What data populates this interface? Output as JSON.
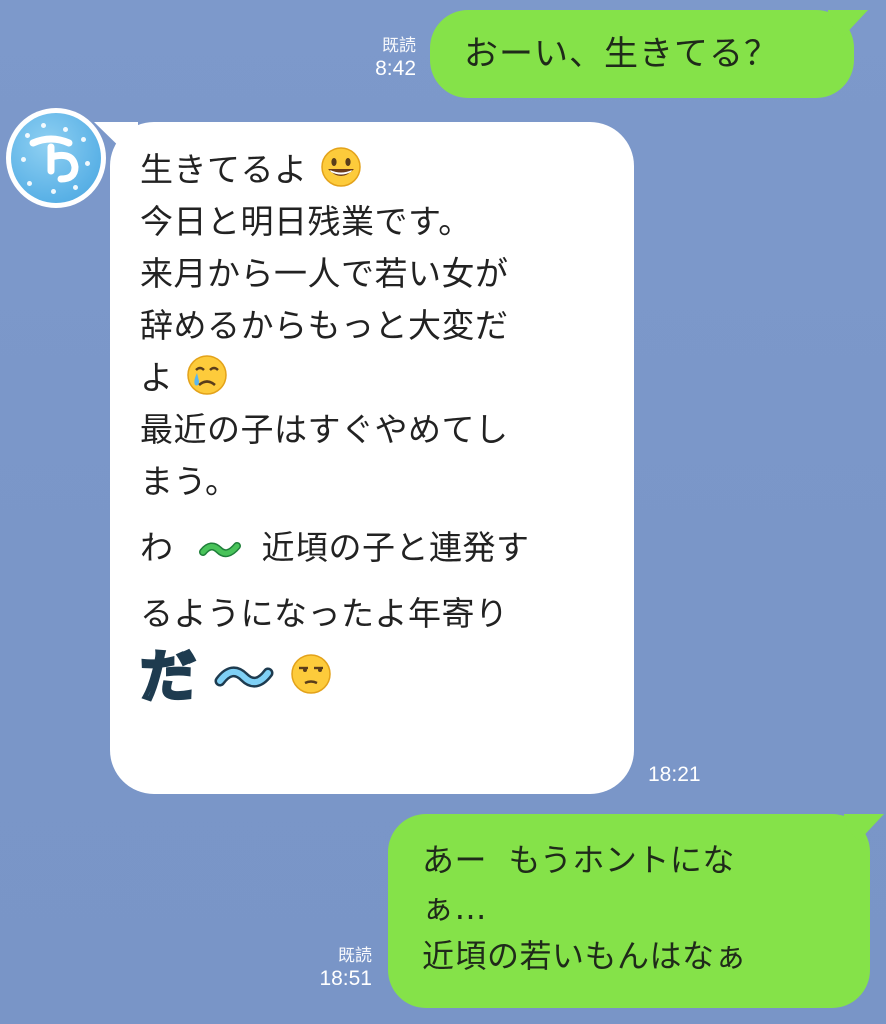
{
  "messages": {
    "m1": {
      "text": "おーい、生きてる？",
      "read": "既読",
      "time": "8:42"
    },
    "m2": {
      "lines": [
        "生きてるよ",
        "今日と明日残業です。",
        "来月から一人で若い女が",
        "辞めるからもっと大変だ",
        "よ",
        "最近の子はすぐやめてし",
        "まう。",
        "わ",
        "近頃の子と連発す",
        "るようになったよ年寄り"
      ],
      "big_text": "だ",
      "time": "18:21"
    },
    "m3": {
      "lines": [
        "あー  もうホントにな",
        "ぁ…",
        "近頃の若いもんはなぁ"
      ],
      "read": "既読",
      "time": "18:51"
    }
  },
  "icons": {
    "avatar": "note-avatar-icon",
    "smile": "grinning-face-emoji",
    "cry": "crying-face-emoji",
    "unamused": "unamused-face-emoji",
    "wave": "green-wave-deco",
    "tilde": "blue-tilde-deco"
  },
  "colors": {
    "background": "#7b97c9",
    "outgoing_bubble": "#85e249",
    "incoming_bubble": "#ffffff"
  }
}
